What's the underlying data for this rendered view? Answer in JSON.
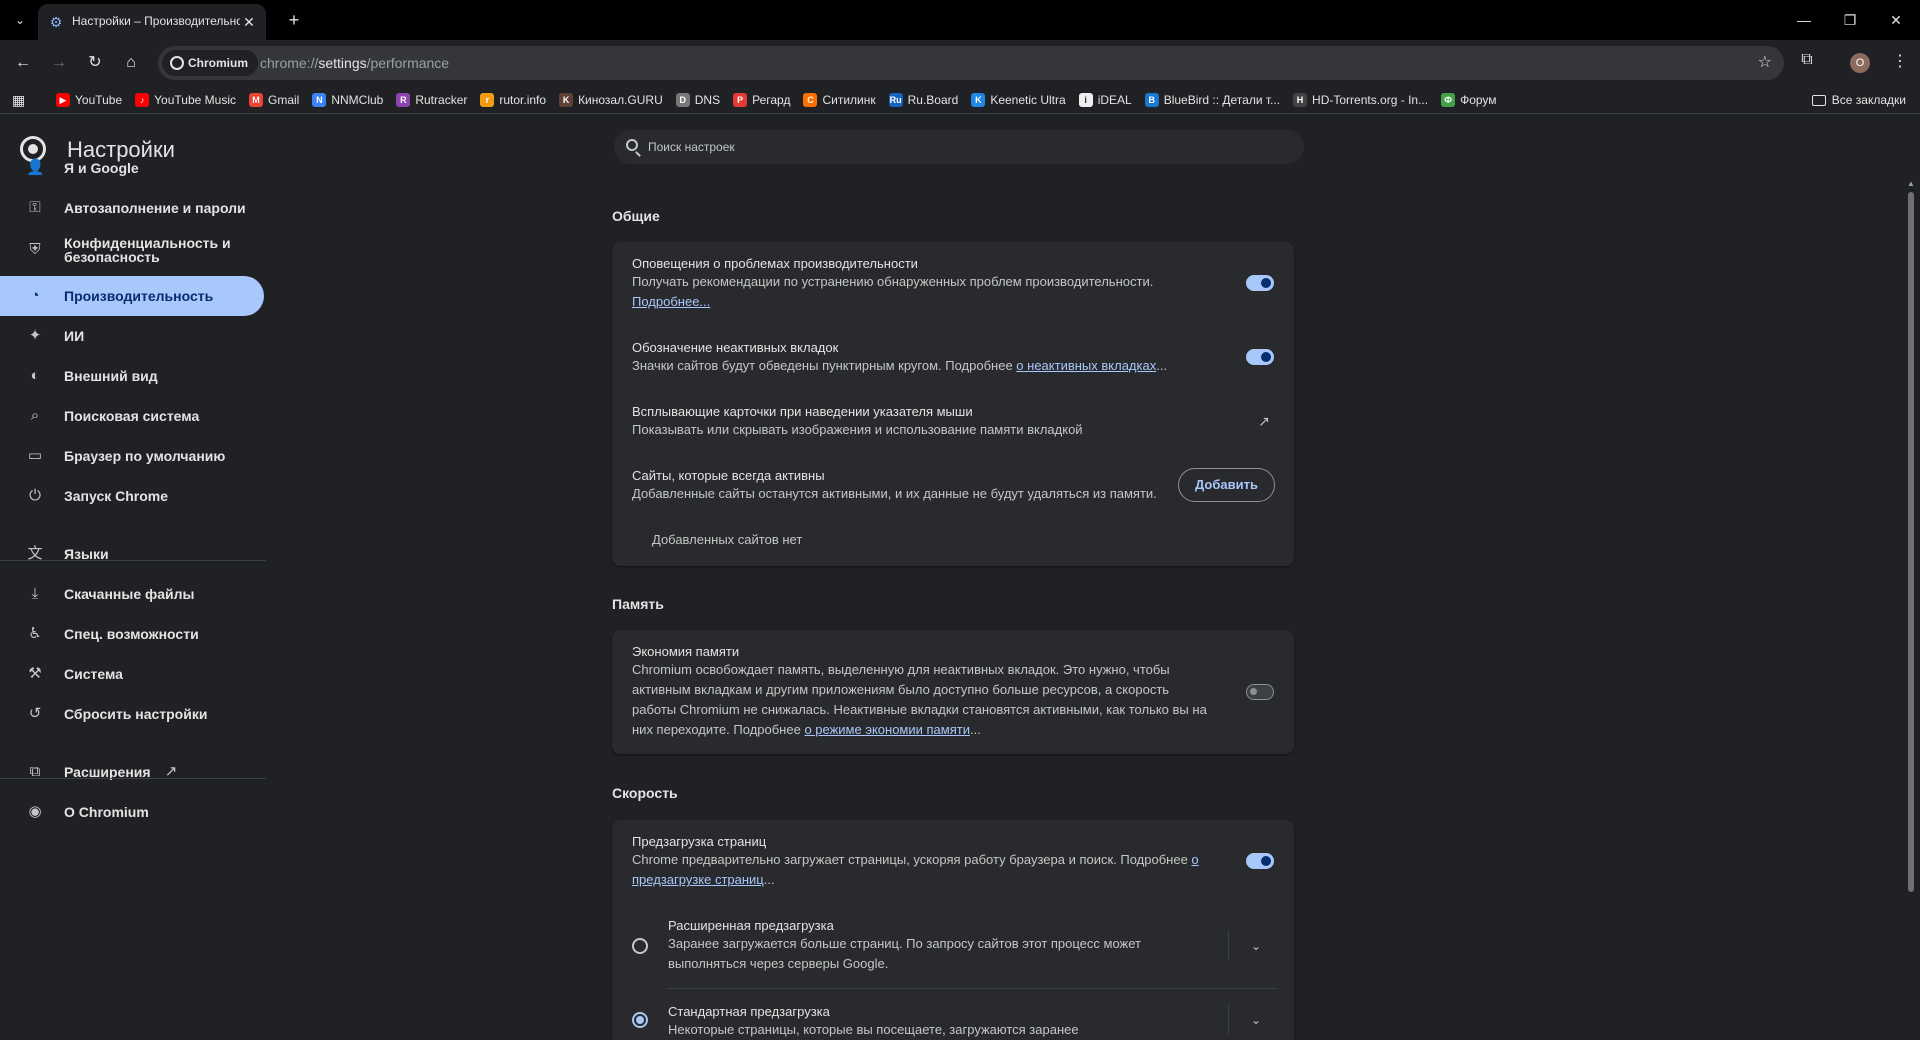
{
  "tab": {
    "title": "Настройки – Производительность",
    "favicon": "gear-icon"
  },
  "window": {
    "minimize": "—",
    "maximize": "❐",
    "close": "✕"
  },
  "toolbar": {
    "site_chip": "Chromium",
    "url_scheme": "chrome://",
    "url_host": "settings",
    "url_path": "/performance",
    "avatar_letter": "О"
  },
  "bookmarks": [
    {
      "label": "YouTube",
      "color": "#ff0000",
      "glyph": "▶"
    },
    {
      "label": "YouTube Music",
      "color": "#ff0000",
      "glyph": "♪"
    },
    {
      "label": "Gmail",
      "color": "#ea4335",
      "glyph": "M"
    },
    {
      "label": "NNMClub",
      "color": "#3b82f6",
      "glyph": "N"
    },
    {
      "label": "Rutracker",
      "color": "#8e44ad",
      "glyph": "R"
    },
    {
      "label": "rutor.info",
      "color": "#f39c12",
      "glyph": "r"
    },
    {
      "label": "Кинозал.GURU",
      "color": "#5d4037",
      "glyph": "K"
    },
    {
      "label": "DNS",
      "color": "#777777",
      "glyph": "D"
    },
    {
      "label": "Регард",
      "color": "#e53935",
      "glyph": "Р"
    },
    {
      "label": "Ситилинк",
      "color": "#ff6f00",
      "glyph": "С"
    },
    {
      "label": "Ru.Board",
      "color": "#1565c0",
      "glyph": "Ru"
    },
    {
      "label": "Keenetic Ultra",
      "color": "#1e88e5",
      "glyph": "K"
    },
    {
      "label": "iDEAL",
      "color": "#eeeeee",
      "glyph": "i"
    },
    {
      "label": "BlueBird :: Детали т...",
      "color": "#1976d2",
      "glyph": "B"
    },
    {
      "label": "HD-Torrents.org - In...",
      "color": "#424242",
      "glyph": "H"
    },
    {
      "label": "Форум",
      "color": "#43a047",
      "glyph": "Ф"
    }
  ],
  "all_bookmarks": "Все закладки",
  "sidebar": {
    "title": "Настройки",
    "items": [
      {
        "label": "Я и Google",
        "icon": "person-icon"
      },
      {
        "label": "Автозаполнение и пароли",
        "icon": "key-icon"
      },
      {
        "label": "Конфиденциальность и безопасность",
        "icon": "shield-icon"
      },
      {
        "label": "Производительность",
        "icon": "speedometer-icon"
      },
      {
        "label": "ИИ",
        "icon": "sparkle-icon"
      },
      {
        "label": "Внешний вид",
        "icon": "palette-icon"
      },
      {
        "label": "Поисковая система",
        "icon": "search-icon"
      },
      {
        "label": "Браузер по умолчанию",
        "icon": "browser-icon"
      },
      {
        "label": "Запуск Chrome",
        "icon": "power-icon"
      },
      {
        "label": "Языки",
        "icon": "translate-icon"
      },
      {
        "label": "Скачанные файлы",
        "icon": "download-icon"
      },
      {
        "label": "Спец. возможности",
        "icon": "accessibility-icon"
      },
      {
        "label": "Система",
        "icon": "wrench-icon"
      },
      {
        "label": "Сбросить настройки",
        "icon": "reset-icon"
      },
      {
        "label": "Расширения",
        "icon": "puzzle-icon"
      },
      {
        "label": "О Chromium",
        "icon": "chromium-icon"
      }
    ]
  },
  "search": {
    "placeholder": "Поиск настроек"
  },
  "general": {
    "title": "Общие",
    "notif_title": "Оповещения о проблемах производительности",
    "notif_desc": "Получать рекомендации по устранению обнаруженных проблем производительности.",
    "notif_link": "Подробнее...",
    "inactive_title": "Обозначение неактивных вкладок",
    "inactive_desc": "Значки сайтов будут обведены пунктирным кругом. Подробнее ",
    "inactive_link": "о неактивных вкладках",
    "inactive_tail": "...",
    "hover_title": "Всплывающие карточки при наведении указателя мыши",
    "hover_desc": "Показывать или скрывать изображения и использование памяти вкладкой",
    "active_title": "Сайты, которые всегда активны",
    "active_desc": "Добавленные сайты останутся активными, и их данные не будут удаляться из памяти.",
    "add_button": "Добавить",
    "no_sites": "Добавленных сайтов нет"
  },
  "memory": {
    "title": "Память",
    "saver_title": "Экономия памяти",
    "saver_desc": "Chromium освобождает память, выделенную для неактивных вкладок. Это нужно, чтобы активным вкладкам и другим приложениям было доступно больше ресурсов, а скорость работы Chromium не снижалась. Неактивные вкладки становятся активными, как только вы на них переходите. Подробнее ",
    "saver_link": "о режиме экономии памяти",
    "saver_tail": "..."
  },
  "speed": {
    "title": "Скорость",
    "preload_title": "Предзагрузка страниц",
    "preload_desc": "Chrome предварительно загружает страницы, ускоряя работу браузера и поиск. Подробнее ",
    "preload_link": "о предзагрузке страниц",
    "preload_tail": "...",
    "extended_title": "Расширенная предзагрузка",
    "extended_desc": "Заранее загружается больше страниц. По запросу сайтов этот процесс может выполняться через серверы Google.",
    "standard_title": "Стандартная предзагрузка",
    "standard_desc": "Некоторые страницы, которые вы посещаете, загружаются заранее"
  },
  "states": {
    "notifications": true,
    "inactive_tabs": true,
    "memory_saver": false,
    "preload": true,
    "preload_mode": "standard"
  }
}
